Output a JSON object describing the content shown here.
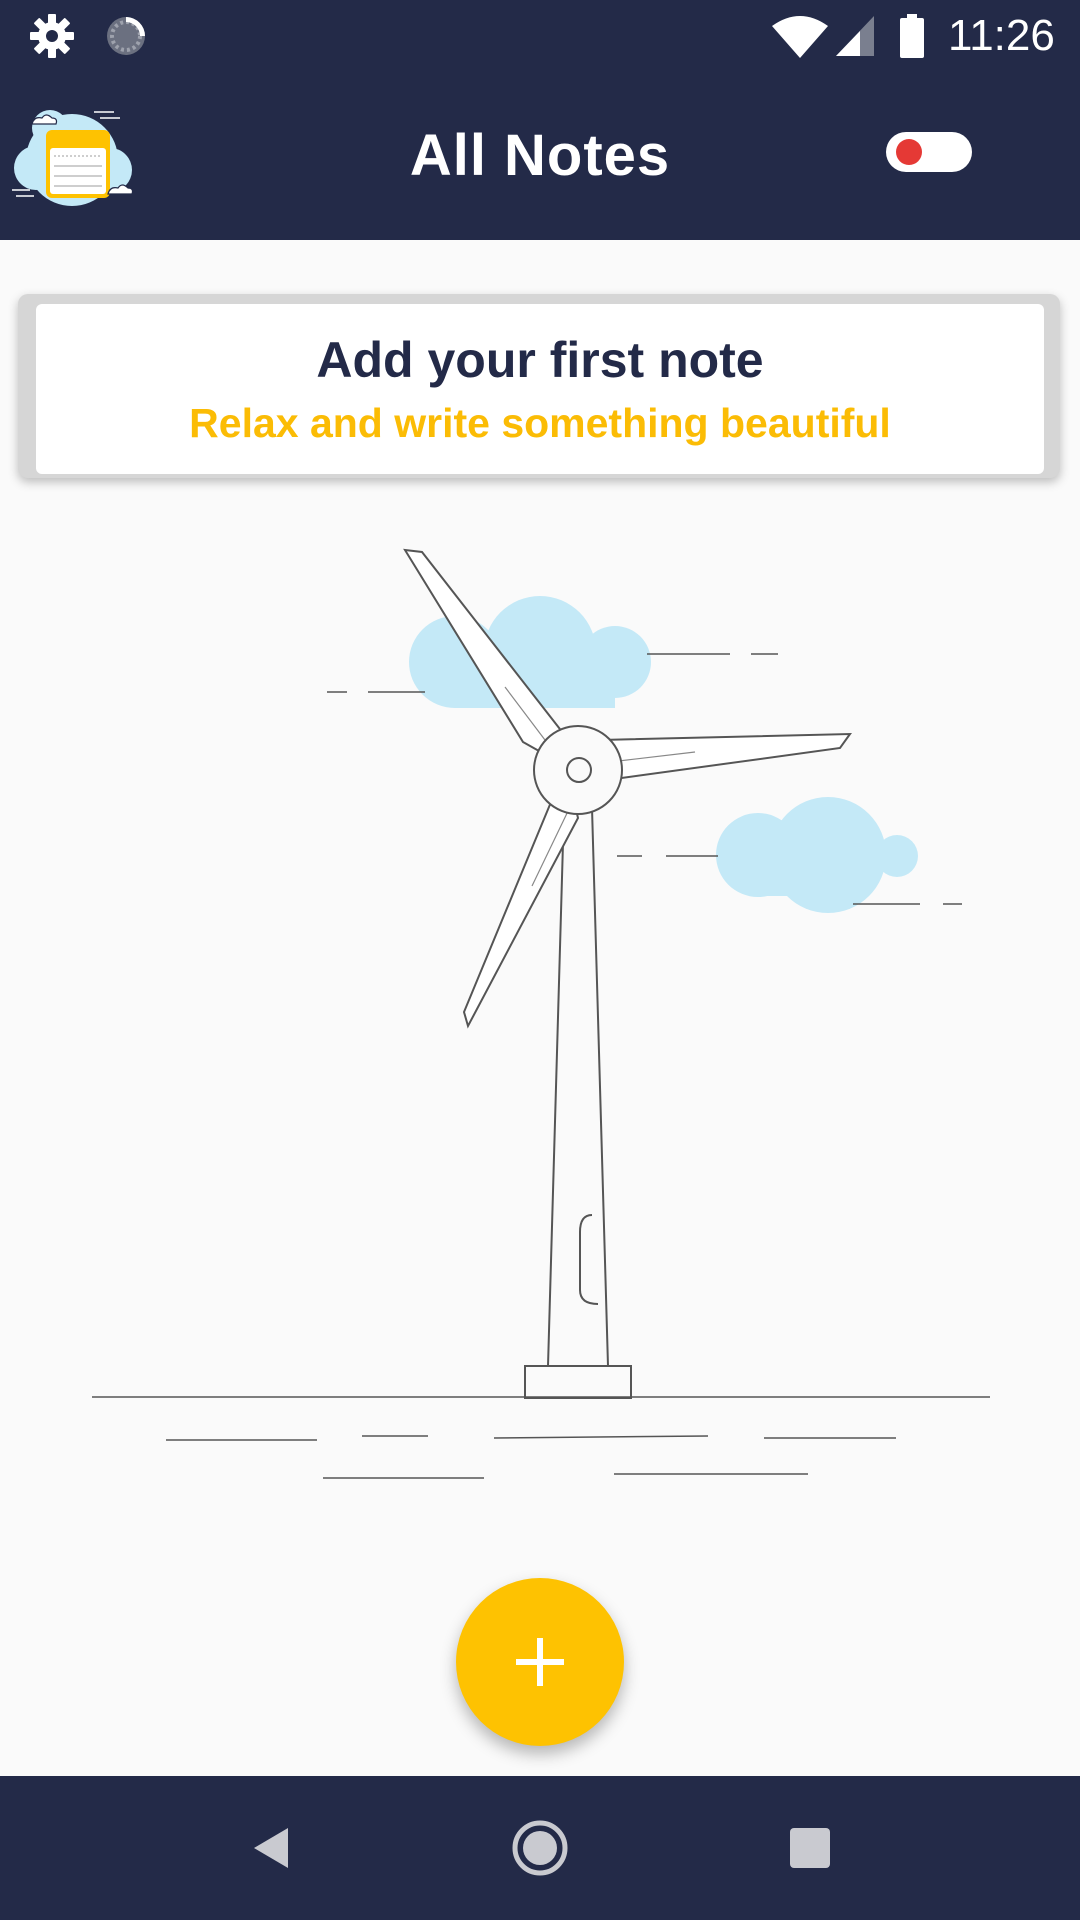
{
  "status_bar": {
    "time": "11:26",
    "icons": [
      "gear-icon",
      "sync-icon",
      "wifi-icon",
      "cell-signal-icon",
      "battery-icon"
    ]
  },
  "app_bar": {
    "title": "All Notes",
    "logo_icon": "notes-cloud-logo",
    "toggle_icon": "theme-toggle"
  },
  "empty_state": {
    "heading": "Add your first note",
    "subheading": "Relax and write something beautiful",
    "illustration_icon": "wind-turbine-illustration"
  },
  "fab": {
    "icon": "plus-icon"
  },
  "nav_bar": {
    "icons": [
      "back-icon",
      "home-icon",
      "recents-icon"
    ]
  },
  "colors": {
    "primary_dark": "#232a48",
    "accent_yellow": "#fec201",
    "subheading_yellow": "#fbbc05",
    "background": "#fafafa",
    "toggle_knob": "#e53935",
    "cloud": "#c4e9f7"
  }
}
